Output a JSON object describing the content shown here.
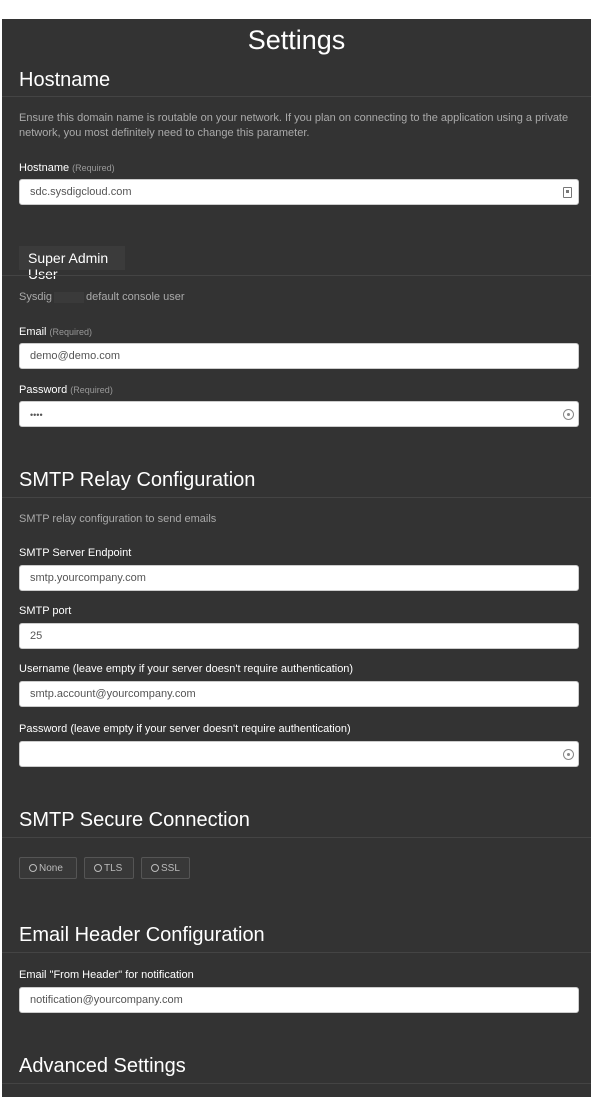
{
  "page": {
    "title": "Settings"
  },
  "hostname": {
    "title": "Hostname",
    "description": "Ensure this domain name is routable on your network. If you plan on connecting to the application using a private network, you most definitely need to change this parameter.",
    "field_label": "Hostname",
    "required": "(Required)",
    "value": "sdc.sysdigcloud.com"
  },
  "super_admin": {
    "title": "Super Admin User",
    "description_before": "Sysdig",
    "description_after": "default console user",
    "email_label": "Email",
    "email_required": "(Required)",
    "email_value": "demo@demo.com",
    "password_label": "Password",
    "password_required": "(Required)",
    "password_value": "••••"
  },
  "smtp": {
    "title": "SMTP Relay Configuration",
    "description": "SMTP relay configuration to send emails",
    "endpoint_label": "SMTP Server Endpoint",
    "endpoint_value": "smtp.yourcompany.com",
    "port_label": "SMTP port",
    "port_value": "25",
    "username_label": "Username (leave empty if your server doesn't require authentication)",
    "username_value": "smtp.account@yourcompany.com",
    "password_label": "Password (leave empty if your server doesn't require authentication)",
    "password_value": ""
  },
  "secure": {
    "title": "SMTP Secure Connection",
    "options": [
      "None",
      "TLS",
      "SSL"
    ]
  },
  "email_header": {
    "title": "Email Header Configuration",
    "from_label": "Email \"From Header\" for notification",
    "from_value": "notification@yourcompany.com"
  },
  "advanced": {
    "title": "Advanced Settings"
  }
}
